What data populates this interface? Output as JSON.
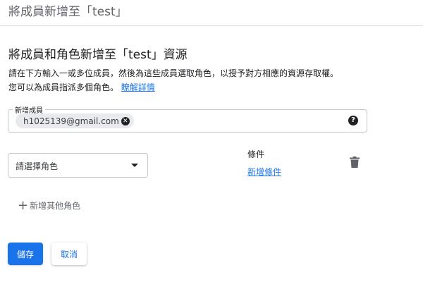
{
  "header": {
    "title": "將成員新增至「test」"
  },
  "section": {
    "title": "將成員和角色新增至「test」資源",
    "description_line1": "請在下方輸入一或多位成員，然後為這些成員選取角色，以授予對方相應的資源存取權。",
    "description_line2": "您可以為成員指派多個角色。",
    "learn_more": "瞭解詳情"
  },
  "new_members": {
    "label": "新增成員",
    "chips": [
      {
        "email": "h1025139@gmail.com"
      }
    ]
  },
  "role": {
    "placeholder": "請選擇角色",
    "condition_label": "條件",
    "add_condition": "新增條件"
  },
  "add_role": {
    "label": "新增其他角色"
  },
  "actions": {
    "save": "儲存",
    "cancel": "取消"
  },
  "colors": {
    "accent": "#1a73e8",
    "chip_bg": "#e8eaed",
    "border": "#c6c7c9"
  },
  "icons": {
    "help": "help-icon",
    "chip_remove": "close-circle-icon",
    "delete": "trash-icon",
    "dropdown": "dropdown-arrow-icon",
    "add": "plus-icon"
  }
}
